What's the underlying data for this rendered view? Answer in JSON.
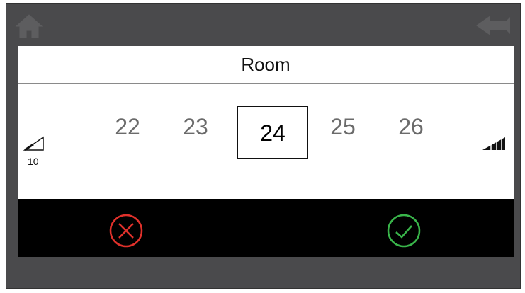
{
  "dialog": {
    "title": "Room",
    "values": [
      "22",
      "23",
      "24",
      "25",
      "26"
    ],
    "selected_value": "24",
    "min_label": "10"
  },
  "icons": {
    "home": "home-icon",
    "back": "back-arrow-icon",
    "volume_low": "signal-low-icon",
    "volume_high": "signal-high-icon",
    "cancel": "cancel-x-circle-icon",
    "confirm": "confirm-check-circle-icon"
  },
  "colors": {
    "cancel": "#e0312b",
    "confirm": "#39b54a",
    "background": "#4a4a4c"
  }
}
